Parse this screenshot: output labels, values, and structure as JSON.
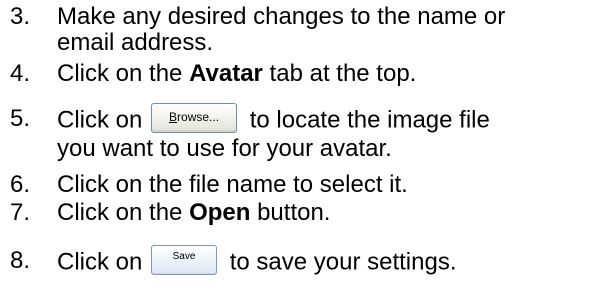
{
  "steps": [
    {
      "number": "3.",
      "lines": [
        "Make any desired changes to the name or",
        "email address."
      ]
    },
    {
      "number": "4.",
      "before": "Click on the ",
      "bold": "Avatar",
      "after": " tab at the top."
    },
    {
      "number": "5.",
      "before": "Click on ",
      "button_mnemonic": "B",
      "button_rest": "rowse...",
      "after": " to locate the image file",
      "line2": "you want to use for your avatar."
    },
    {
      "number": "6.",
      "text": "Click on the file name to select it."
    },
    {
      "number": "7.",
      "before": "Click on the ",
      "bold": "Open",
      "after": " button."
    },
    {
      "number": "8.",
      "before": "Click on ",
      "button_label": "Save",
      "after": " to save your settings."
    }
  ]
}
